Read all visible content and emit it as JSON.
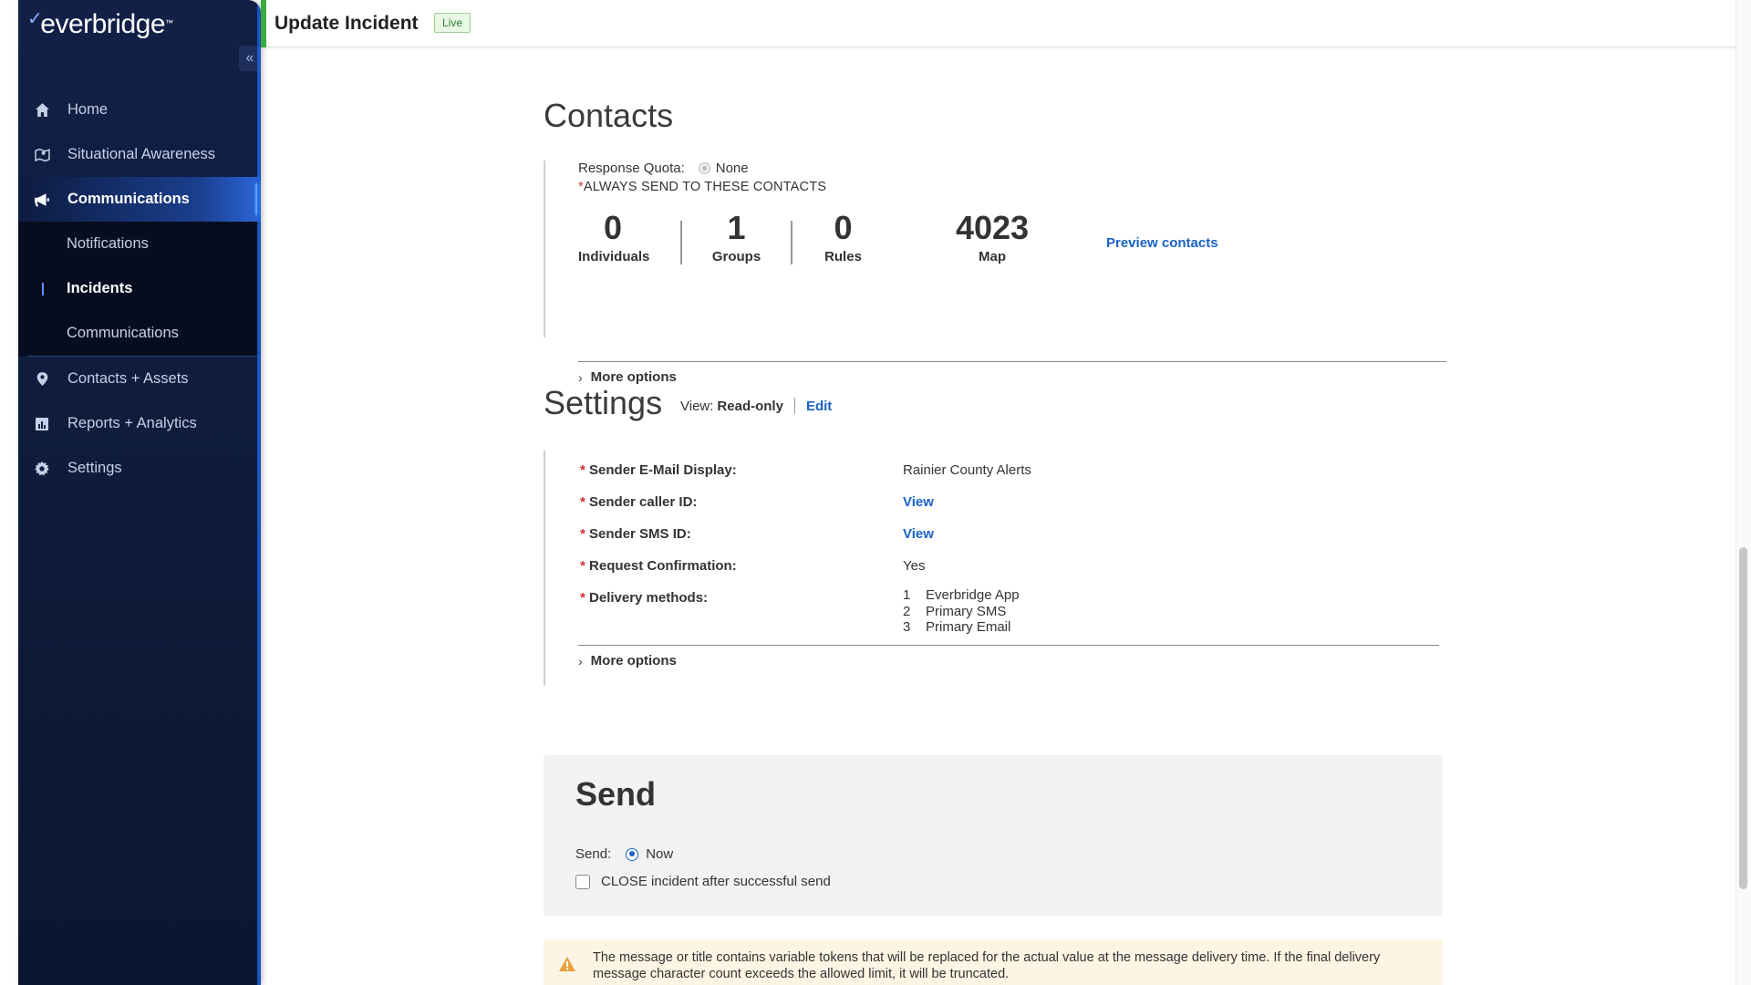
{
  "brand": {
    "name": "everbridge",
    "mark": "✓",
    "trademark": "™"
  },
  "sidebar": {
    "collapse_label": "«",
    "items": [
      {
        "label": "Home",
        "icon": "home-icon"
      },
      {
        "label": "Situational Awareness",
        "icon": "map-icon"
      },
      {
        "label": "Communications",
        "icon": "megaphone-icon"
      },
      {
        "label": "Contacts + Assets",
        "icon": "location-pin-icon"
      },
      {
        "label": "Reports + Analytics",
        "icon": "chart-icon"
      },
      {
        "label": "Settings",
        "icon": "gear-icon"
      }
    ],
    "sub_items": [
      {
        "label": "Notifications"
      },
      {
        "label": "Incidents"
      },
      {
        "label": "Communications"
      }
    ]
  },
  "header": {
    "title": "Update Incident",
    "status": "Live"
  },
  "contacts": {
    "title": "Contacts",
    "response_quota_label": "Response Quota:",
    "response_quota_value": "None",
    "always_send_star": "*",
    "always_send_label": "ALWAYS SEND TO THESE CONTACTS",
    "stats": [
      {
        "value": "0",
        "label": "Individuals"
      },
      {
        "value": "1",
        "label": "Groups"
      },
      {
        "value": "0",
        "label": "Rules"
      },
      {
        "value": "4023",
        "label": "Map"
      }
    ],
    "preview_link": "Preview contacts",
    "more_options": "More options"
  },
  "settings": {
    "title": "Settings",
    "view_label": "View:",
    "view_mode": "Read-only",
    "edit_link": "Edit",
    "required_star": "*",
    "rows": [
      {
        "label": "Sender E-Mail Display:",
        "value": "Rainier County Alerts"
      },
      {
        "label": "Sender caller ID:",
        "value": "View"
      },
      {
        "label": "Sender SMS ID:",
        "value": "View"
      },
      {
        "label": "Request Confirmation:",
        "value": "Yes"
      },
      {
        "label": "Delivery methods:"
      }
    ],
    "delivery_methods": [
      {
        "n": "1",
        "name": "Everbridge App"
      },
      {
        "n": "2",
        "name": "Primary SMS"
      },
      {
        "n": "3",
        "name": "Primary Email"
      }
    ],
    "more_options": "More options"
  },
  "send": {
    "title": "Send",
    "send_label": "Send:",
    "send_option": "Now",
    "close_label": "CLOSE incident after successful send"
  },
  "warning": {
    "text": "The message or title contains variable tokens that will be replaced for the actual value at the message delivery time. If the final delivery message character count exceeds the allowed limit, it will be truncated."
  },
  "colors": {
    "sidebar_bg": "#122047",
    "link": "#1a62c4",
    "live_accent": "#3caa3c",
    "required": "#d32f2f",
    "warning_bg": "#fdf4e4",
    "warning_icon": "#e6a23c"
  }
}
